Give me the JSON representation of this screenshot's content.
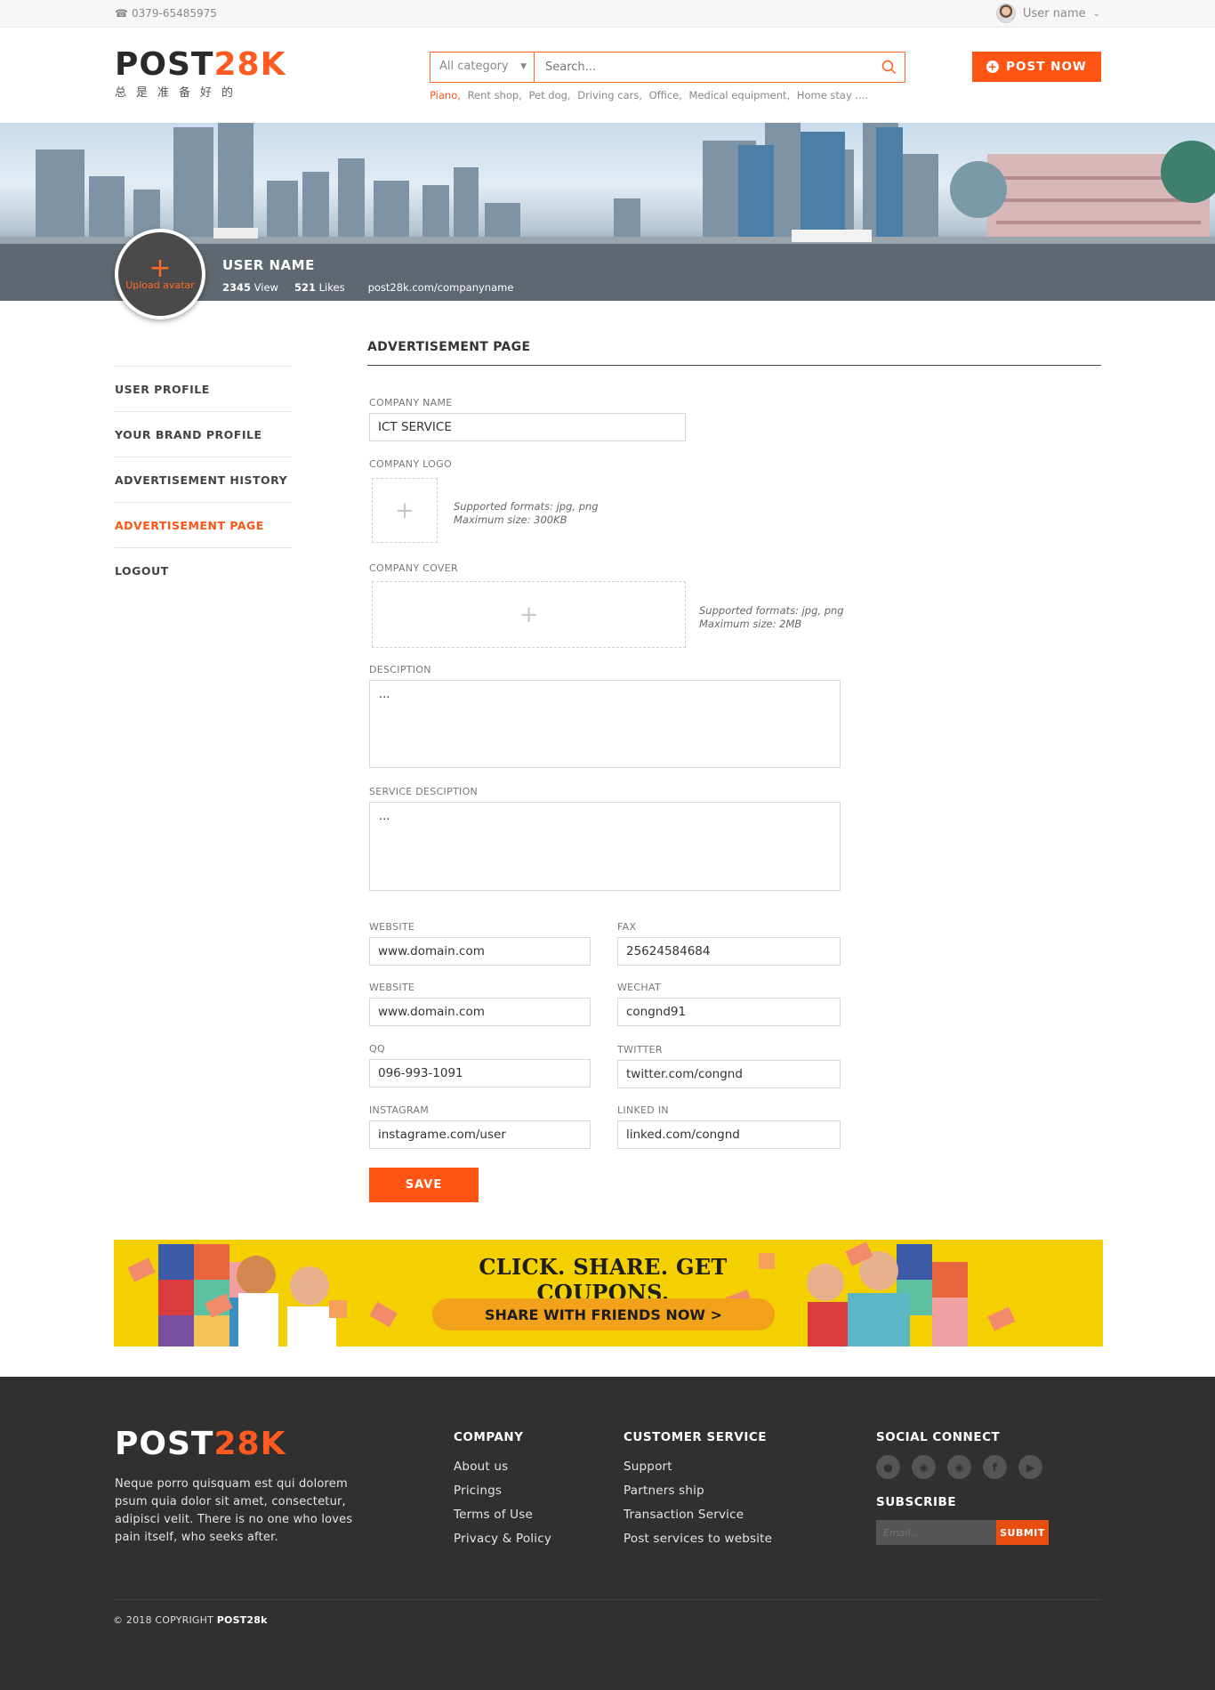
{
  "topbar": {
    "phone": "0379-65485975",
    "username": "User name"
  },
  "header": {
    "logo_dark": "POST",
    "logo_accent": "28K",
    "logo_tagline": "总是准备好的",
    "category": "All category",
    "search_placeholder": "Search...",
    "tags": [
      "Piano,",
      "Rent shop,",
      "Pet dog,",
      "Driving cars,",
      "Office,",
      "Medical equipment,",
      "Home stay ...."
    ],
    "post_button": "POST NOW"
  },
  "profile": {
    "upload_avatar": "Upload avatar",
    "name": "USER NAME",
    "views_count": "2345",
    "views_label": "View",
    "likes_count": "521",
    "likes_label": "Likes",
    "url": "post28k.com/companyname"
  },
  "sidebar": {
    "items": [
      {
        "label": "USER PROFILE"
      },
      {
        "label": "YOUR BRAND  PROFILE"
      },
      {
        "label": "ADVERTISEMENT HISTORY"
      },
      {
        "label": "ADVERTISEMENT PAGE"
      },
      {
        "label": "LOGOUT"
      }
    ]
  },
  "form": {
    "title": "ADVERTISEMENT PAGE",
    "company_name_label": "COMPANY NAME",
    "company_name": "ICT SERVICE",
    "company_logo_label": "COMPANY LOGO",
    "logo_formats": "Supported formats: jpg, png",
    "logo_size": "Maximum size: 300KB",
    "company_cover_label": "COMPANY COVER",
    "cover_formats": "Supported formats: jpg, png",
    "cover_size": "Maximum size: 2MB",
    "description_label": "DESCIPTION",
    "description": "...",
    "service_description_label": "SERVICE DESCIPTION",
    "service_description": "...",
    "website1_label": "WEBSITE",
    "website1": "www.domain.com",
    "fax_label": "FAX",
    "fax": "25624584684",
    "website2_label": "WEBSITE",
    "website2": "www.domain.com",
    "wechat_label": "WECHAT",
    "wechat": "congnd91",
    "qq_label": "QQ",
    "qq": "096-993-1091",
    "twitter_label": "TWITTER",
    "twitter": "twitter.com/congnd",
    "instagram_label": "INSTAGRAM",
    "instagram": "instagrame.com/user",
    "linkedin_label": "LINKED IN",
    "linkedin": "linked.com/congnd",
    "save_label": "SAVE"
  },
  "promo": {
    "headline": "CLICK. SHARE. GET COUPONS.",
    "button": "SHARE WITH FRIENDS NOW  >"
  },
  "footer": {
    "logo_light": "POST",
    "logo_accent": "28K",
    "about": "Neque porro quisquam est qui dolorem psum quia dolor sit amet, consectetur, adipisci velit. There is no one who loves pain itself, who seeks after.",
    "company_title": "COMPANY",
    "company_links": [
      "About us",
      "Pricings",
      "Terms of Use",
      "Privacy & Policy"
    ],
    "service_title": "CUSTOMER SERVICE",
    "service_links": [
      "Support",
      "Partners ship",
      "Transaction Service",
      "Post services to website"
    ],
    "social_title": "SOCIAL CONNECT",
    "social_icons": [
      "qq-icon",
      "weibo-icon",
      "wechat-icon",
      "facebook-icon",
      "youtube-icon"
    ],
    "subscribe_title": "SUBSCRIBE",
    "email_placeholder": "Email...",
    "submit_label": "SUBMIT",
    "copyright": "© 2018 COPYRIGHT",
    "copyright_brand": "POST28k"
  },
  "colors": {
    "accent": "#ff5414",
    "footer_bg": "#303030",
    "promo_bg": "#f5d000"
  }
}
